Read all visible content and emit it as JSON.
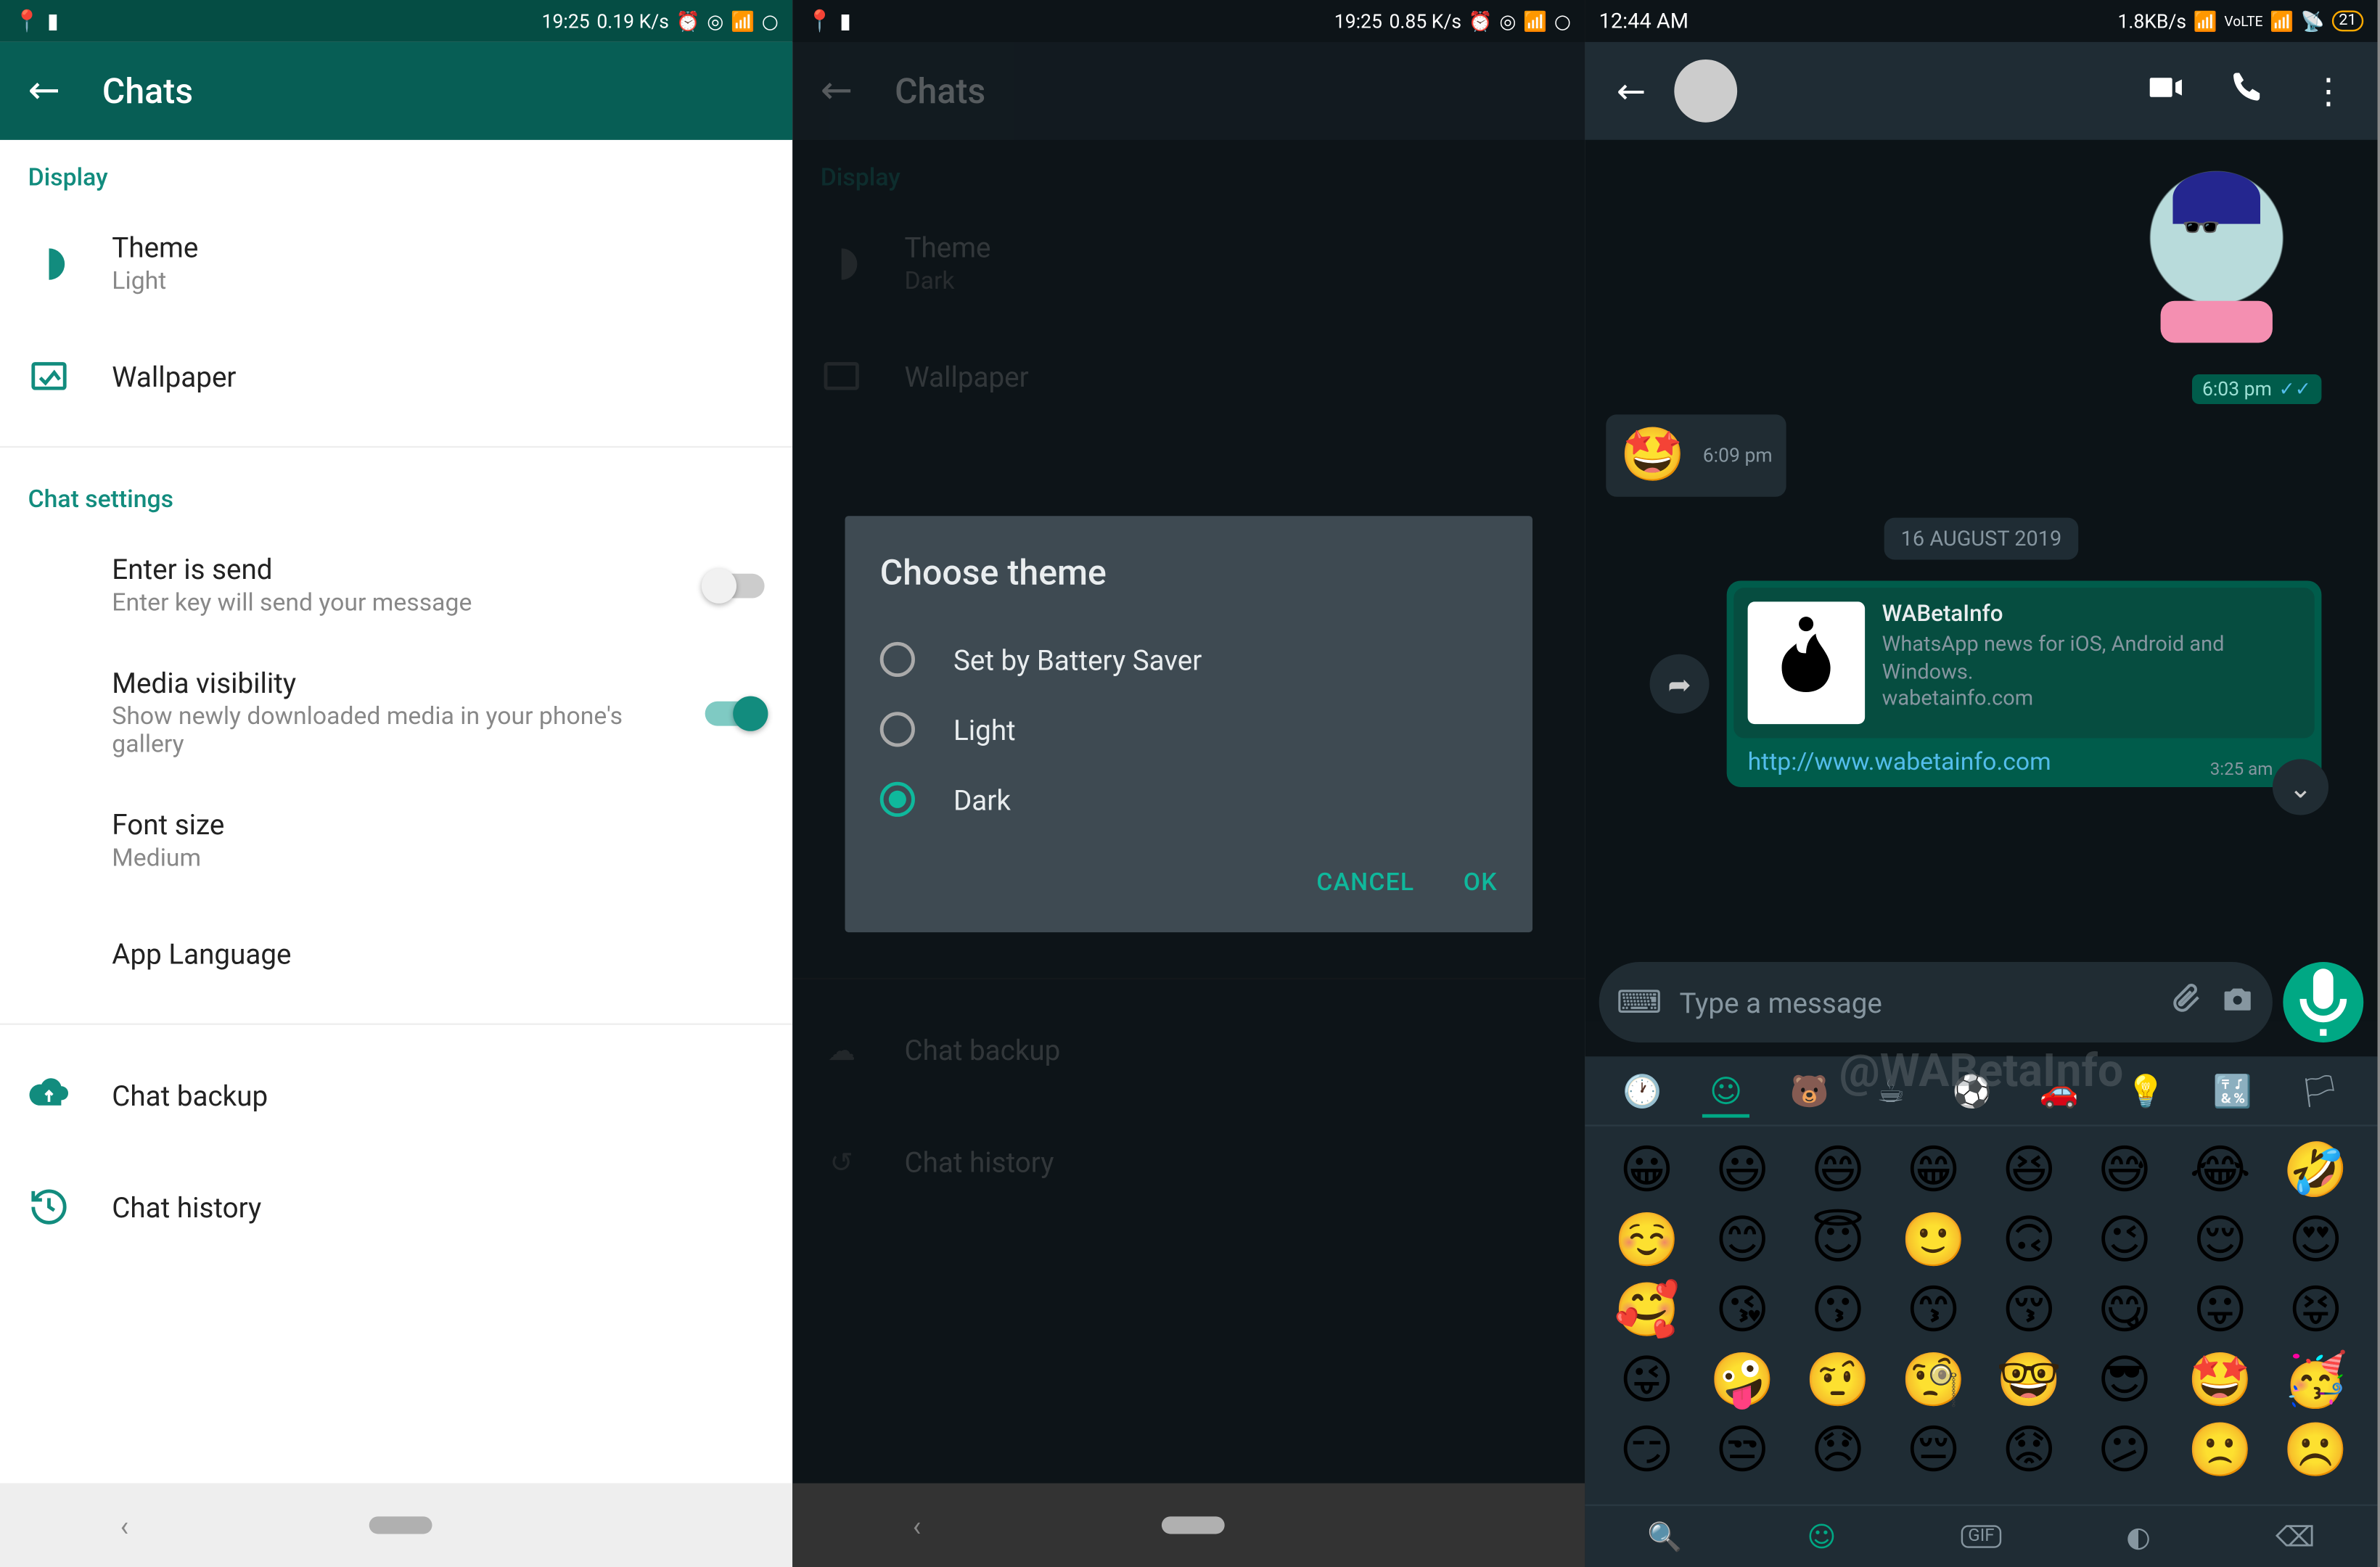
{
  "s1": {
    "status": {
      "time": "19:25",
      "data": "0.19 K/s"
    },
    "toolbar": {
      "title": "Chats"
    },
    "display_header": "Display",
    "theme": {
      "title": "Theme",
      "value": "Light"
    },
    "wallpaper": "Wallpaper",
    "chat_settings_header": "Chat settings",
    "enter_send": {
      "title": "Enter is send",
      "desc": "Enter key will send your message"
    },
    "media_vis": {
      "title": "Media visibility",
      "desc": "Show newly downloaded media in your phone's gallery"
    },
    "font_size": {
      "title": "Font size",
      "value": "Medium"
    },
    "app_lang": "App Language",
    "chat_backup": "Chat backup",
    "chat_history": "Chat history"
  },
  "s2": {
    "status": {
      "time": "19:25",
      "data": "0.85 K/s"
    },
    "toolbar": {
      "title": "Chats"
    },
    "theme": {
      "title": "Theme",
      "value": "Dark"
    },
    "wallpaper": "Wallpaper",
    "app_lang": "App Language",
    "chat_backup": "Chat backup",
    "chat_history": "Chat history",
    "dialog": {
      "title": "Choose theme",
      "opt1": "Set by Battery Saver",
      "opt2": "Light",
      "opt3": "Dark",
      "cancel": "CANCEL",
      "ok": "OK"
    }
  },
  "s3": {
    "status": {
      "time": "12:44 AM",
      "data": "1.8KB/s",
      "battery": "21"
    },
    "time1": "6:03 pm",
    "emoji_in": "🤩",
    "time2": "6:09 pm",
    "date": "16 AUGUST 2019",
    "link": {
      "title": "WABetaInfo",
      "desc": "WhatsApp news for iOS, Android and Windows.",
      "domain": "wabetainfo.com",
      "url": "http://www.wabetainfo.com",
      "time": "3:25 am"
    },
    "input_placeholder": "Type a message",
    "watermark": "@WABetaInfo",
    "emoji_grid": [
      "😀",
      "😃",
      "😄",
      "😁",
      "😆",
      "😅",
      "😂",
      "🤣",
      "☺️",
      "😊",
      "😇",
      "🙂",
      "🙃",
      "😉",
      "😌",
      "😍",
      "🥰",
      "😘",
      "😗",
      "😙",
      "😚",
      "😋",
      "😛",
      "😝",
      "😜",
      "🤪",
      "🤨",
      "🧐",
      "🤓",
      "😎",
      "🤩",
      "🥳",
      "😏",
      "😒",
      "😞",
      "😔",
      "😟",
      "😕",
      "🙁",
      "☹️"
    ]
  }
}
